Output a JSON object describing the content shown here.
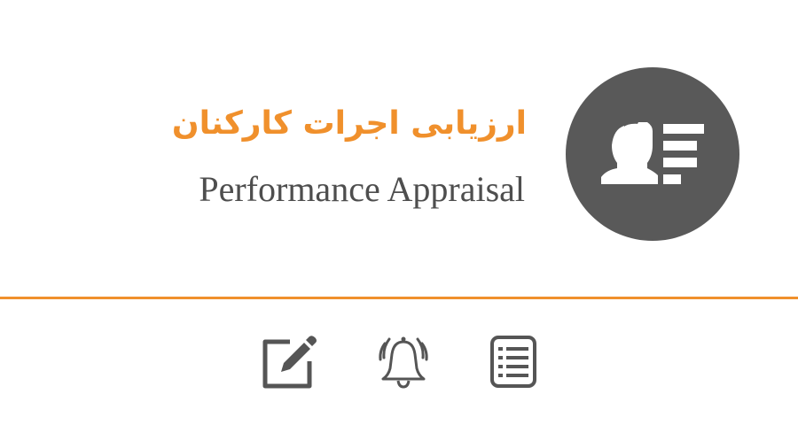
{
  "header": {
    "title_fa": "ارزیابی اجرات کارکنان",
    "title_en": "Performance Appraisal"
  },
  "icons": {
    "hero": "employee-list-icon",
    "actions": [
      "edit-icon",
      "bell-icon",
      "list-icon"
    ]
  },
  "colors": {
    "accent": "#f0902c",
    "circle": "#595959",
    "icon": "#555555",
    "text": "#4e4e4e",
    "background": "#ffffff"
  }
}
